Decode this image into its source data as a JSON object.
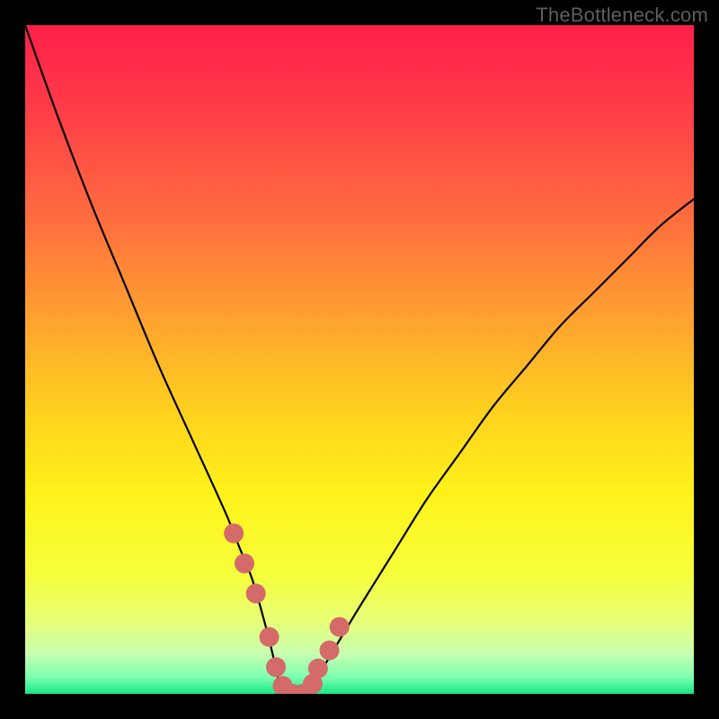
{
  "watermark": {
    "text": "TheBottleneck.com"
  },
  "chart_data": {
    "type": "line",
    "title": "",
    "xlabel": "",
    "ylabel": "",
    "xlim": [
      0,
      100
    ],
    "ylim": [
      0,
      100
    ],
    "grid": false,
    "legend": false,
    "series": [
      {
        "name": "bottleneck-curve",
        "x": [
          0,
          5,
          10,
          15,
          20,
          25,
          30,
          32,
          34,
          36,
          37,
          38,
          40,
          42,
          44,
          47,
          50,
          55,
          60,
          65,
          70,
          75,
          80,
          85,
          90,
          95,
          100
        ],
        "values": [
          100,
          86,
          73,
          61,
          49,
          38,
          27,
          22,
          17,
          10,
          6,
          2,
          0,
          0,
          3,
          8,
          13,
          21,
          29,
          36,
          43,
          49,
          55,
          60,
          65,
          70,
          74
        ]
      }
    ],
    "markers": {
      "name": "highlight-points",
      "color": "#d46a6a",
      "x": [
        31.2,
        32.8,
        34.5,
        36.5,
        37.5,
        38.5,
        40.0,
        41.5,
        43.0,
        43.8,
        45.5,
        47.0
      ],
      "values": [
        24.0,
        19.5,
        15.0,
        8.5,
        4.0,
        1.2,
        0.0,
        0.0,
        1.5,
        3.8,
        6.5,
        10.0
      ]
    },
    "gradient_stops": [
      {
        "offset": 0.0,
        "color": "#ff1f4a"
      },
      {
        "offset": 0.12,
        "color": "#ff3b48"
      },
      {
        "offset": 0.28,
        "color": "#ff6a3f"
      },
      {
        "offset": 0.44,
        "color": "#ffa22f"
      },
      {
        "offset": 0.58,
        "color": "#ffd21e"
      },
      {
        "offset": 0.7,
        "color": "#fff21a"
      },
      {
        "offset": 0.82,
        "color": "#f6ff3b"
      },
      {
        "offset": 0.89,
        "color": "#e8ff76"
      },
      {
        "offset": 0.94,
        "color": "#c8ffb0"
      },
      {
        "offset": 0.975,
        "color": "#7dffb0"
      },
      {
        "offset": 1.0,
        "color": "#17e884"
      }
    ]
  }
}
